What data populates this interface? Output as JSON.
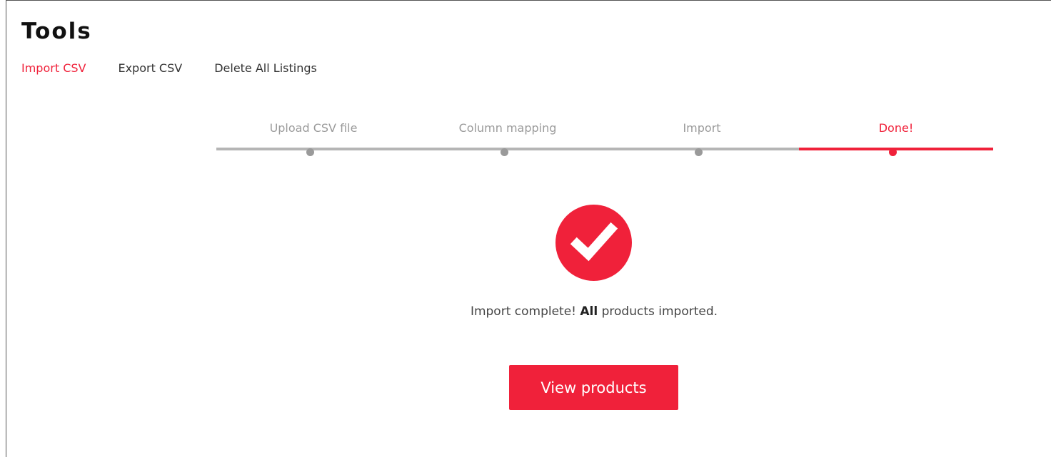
{
  "page": {
    "title": "Tools"
  },
  "tools_nav": {
    "items": [
      {
        "label": "Import CSV",
        "active": true
      },
      {
        "label": "Export CSV",
        "active": false
      },
      {
        "label": "Delete All Listings",
        "active": false
      }
    ]
  },
  "stepper": {
    "steps": [
      {
        "label": "Upload CSV file",
        "active": false
      },
      {
        "label": "Column mapping",
        "active": false
      },
      {
        "label": "Import",
        "active": false
      },
      {
        "label": "Done!",
        "active": true
      }
    ]
  },
  "result": {
    "icon": "checkmark-icon",
    "message_prefix": "Import complete!",
    "message_bold": "All",
    "message_suffix": "products imported.",
    "button_label": "View products"
  },
  "colors": {
    "accent": "#f0213a",
    "inactive_step": "#9a9a9a",
    "inactive_bar": "#b5b5b5"
  }
}
